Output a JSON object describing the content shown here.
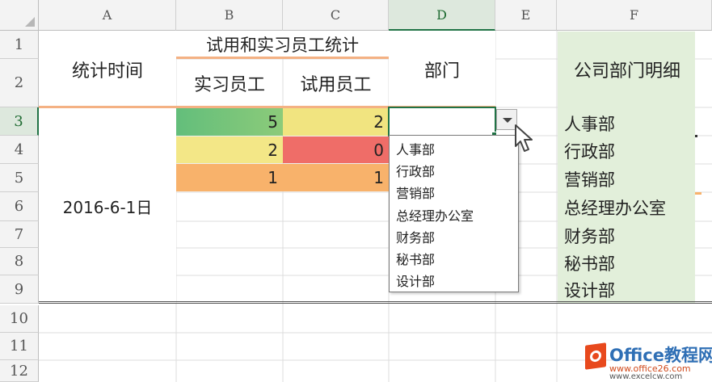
{
  "columns": [
    "A",
    "B",
    "C",
    "D",
    "E",
    "F"
  ],
  "rows": [
    "1",
    "2",
    "3",
    "4",
    "5",
    "6",
    "7",
    "8",
    "9",
    "10",
    "11",
    "12"
  ],
  "header": {
    "stat_time": "统计时间",
    "group_title": "试用和实习员工统计",
    "intern": "实习员工",
    "probation": "试用员工",
    "department": "部门",
    "dept_list_title": "公司部门明细"
  },
  "date_value": "2016-6-1日",
  "stats": [
    {
      "intern": "5",
      "probation": "2"
    },
    {
      "intern": "2",
      "probation": "0"
    },
    {
      "intern": "1",
      "probation": "1"
    }
  ],
  "dropdown": {
    "options": [
      "人事部",
      "行政部",
      "营销部",
      "总经理办公室",
      "财务部",
      "秘书部",
      "设计部"
    ]
  },
  "departments": [
    "人事部",
    "行政部",
    "营销部",
    "总经理办公室",
    "财务部",
    "秘书部",
    "设计部"
  ],
  "watermark": {
    "brand": "Office教程网",
    "url": "www.office26.com",
    "url2": "www.excelcw.com"
  },
  "colors": {
    "green": "#63be7b",
    "yellow": "#f3e787",
    "red": "#f0706a",
    "orange": "#f8b26b",
    "light_green": "#e2efda",
    "accent": "#217346"
  }
}
